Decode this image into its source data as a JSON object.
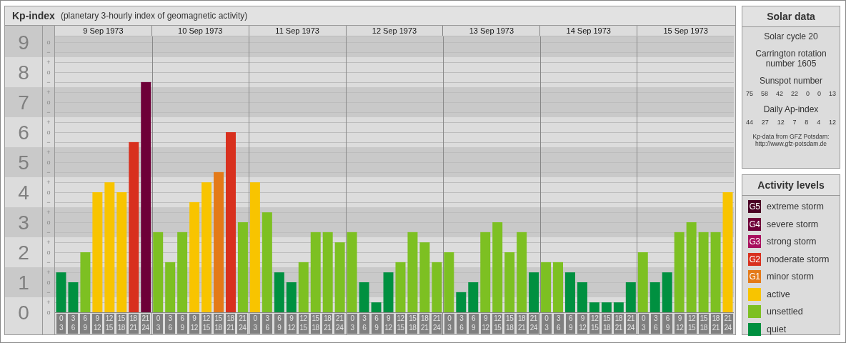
{
  "header": {
    "title": "Kp-index",
    "subtitle": "(planetary 3-hourly index of geomagnetic activity)"
  },
  "y_axis_minor": [
    [
      {
        "label": "o",
        "kind": "zero"
      },
      {
        "label": "−",
        "kind": "minus"
      }
    ],
    [
      {
        "label": "+",
        "kind": "plus"
      },
      {
        "label": "o",
        "kind": "zero"
      },
      {
        "label": "−",
        "kind": "minus"
      }
    ],
    [
      {
        "label": "+",
        "kind": "plus"
      },
      {
        "label": "o",
        "kind": "zero"
      },
      {
        "label": "−",
        "kind": "minus"
      }
    ],
    [
      {
        "label": "+",
        "kind": "plus"
      },
      {
        "label": "o",
        "kind": "zero"
      },
      {
        "label": "−",
        "kind": "minus"
      }
    ],
    [
      {
        "label": "+",
        "kind": "plus"
      },
      {
        "label": "o",
        "kind": "zero"
      },
      {
        "label": "−",
        "kind": "minus"
      }
    ],
    [
      {
        "label": "+",
        "kind": "plus"
      },
      {
        "label": "o",
        "kind": "zero"
      },
      {
        "label": "−",
        "kind": "minus"
      }
    ],
    [
      {
        "label": "+",
        "kind": "plus"
      },
      {
        "label": "o",
        "kind": "zero"
      },
      {
        "label": "−",
        "kind": "minus"
      }
    ],
    [
      {
        "label": "+",
        "kind": "plus"
      },
      {
        "label": "o",
        "kind": "zero"
      },
      {
        "label": "−",
        "kind": "minus"
      }
    ],
    [
      {
        "label": "+",
        "kind": "plus"
      },
      {
        "label": "o",
        "kind": "zero"
      },
      {
        "label": "−",
        "kind": "minus"
      }
    ],
    [
      {
        "label": "+",
        "kind": "plus"
      },
      {
        "label": "o",
        "kind": "zero"
      }
    ]
  ],
  "days": [
    {
      "date": "9 Sep 1973",
      "slots": [
        {
          "start": "0",
          "end": "3"
        },
        {
          "start": "3",
          "end": "6"
        },
        {
          "start": "6",
          "end": "9"
        },
        {
          "start": "9",
          "end": "12"
        },
        {
          "start": "12",
          "end": "15"
        },
        {
          "start": "15",
          "end": "18"
        },
        {
          "start": "18",
          "end": "21"
        },
        {
          "start": "21",
          "end": "24"
        }
      ]
    },
    {
      "date": "10 Sep 1973",
      "slots": [
        {
          "start": "0",
          "end": "3"
        },
        {
          "start": "3",
          "end": "6"
        },
        {
          "start": "6",
          "end": "9"
        },
        {
          "start": "9",
          "end": "12"
        },
        {
          "start": "12",
          "end": "15"
        },
        {
          "start": "15",
          "end": "18"
        },
        {
          "start": "18",
          "end": "21"
        },
        {
          "start": "21",
          "end": "24"
        }
      ]
    },
    {
      "date": "11 Sep 1973",
      "slots": [
        {
          "start": "0",
          "end": "3"
        },
        {
          "start": "3",
          "end": "6"
        },
        {
          "start": "6",
          "end": "9"
        },
        {
          "start": "9",
          "end": "12"
        },
        {
          "start": "12",
          "end": "15"
        },
        {
          "start": "15",
          "end": "18"
        },
        {
          "start": "18",
          "end": "21"
        },
        {
          "start": "21",
          "end": "24"
        }
      ]
    },
    {
      "date": "12 Sep 1973",
      "slots": [
        {
          "start": "0",
          "end": "3"
        },
        {
          "start": "3",
          "end": "6"
        },
        {
          "start": "6",
          "end": "9"
        },
        {
          "start": "9",
          "end": "12"
        },
        {
          "start": "12",
          "end": "15"
        },
        {
          "start": "15",
          "end": "18"
        },
        {
          "start": "18",
          "end": "21"
        },
        {
          "start": "21",
          "end": "24"
        }
      ]
    },
    {
      "date": "13 Sep 1973",
      "slots": [
        {
          "start": "0",
          "end": "3"
        },
        {
          "start": "3",
          "end": "6"
        },
        {
          "start": "6",
          "end": "9"
        },
        {
          "start": "9",
          "end": "12"
        },
        {
          "start": "12",
          "end": "15"
        },
        {
          "start": "15",
          "end": "18"
        },
        {
          "start": "18",
          "end": "21"
        },
        {
          "start": "21",
          "end": "24"
        }
      ]
    },
    {
      "date": "14 Sep 1973",
      "slots": [
        {
          "start": "0",
          "end": "3"
        },
        {
          "start": "3",
          "end": "6"
        },
        {
          "start": "6",
          "end": "9"
        },
        {
          "start": "9",
          "end": "12"
        },
        {
          "start": "12",
          "end": "15"
        },
        {
          "start": "15",
          "end": "18"
        },
        {
          "start": "18",
          "end": "21"
        },
        {
          "start": "21",
          "end": "24"
        }
      ]
    },
    {
      "date": "15 Sep 1973",
      "slots": [
        {
          "start": "0",
          "end": "3"
        },
        {
          "start": "3",
          "end": "6"
        },
        {
          "start": "6",
          "end": "9"
        },
        {
          "start": "9",
          "end": "12"
        },
        {
          "start": "12",
          "end": "15"
        },
        {
          "start": "15",
          "end": "18"
        },
        {
          "start": "18",
          "end": "21"
        },
        {
          "start": "21",
          "end": "24"
        }
      ]
    }
  ],
  "chart_data": {
    "type": "bar",
    "grid": true,
    "ylim": [
      0,
      9
    ],
    "yticks": [
      0,
      1,
      2,
      3,
      4,
      5,
      6,
      7,
      8,
      9
    ],
    "categories": [
      null,
      null,
      null,
      null,
      null,
      null,
      null,
      null,
      null,
      null,
      null,
      null,
      null,
      null,
      null,
      null,
      null,
      null,
      null,
      null,
      null,
      null,
      null,
      null,
      null,
      null,
      null,
      null,
      null,
      null,
      null,
      null,
      null,
      null,
      null,
      null,
      null,
      null,
      null,
      null,
      null,
      null,
      null,
      null,
      null,
      null,
      null,
      null,
      null,
      null,
      null,
      null,
      null,
      null,
      null,
      null
    ],
    "values": [
      1.33,
      1,
      2,
      4,
      4.33,
      4,
      5.67,
      7.67,
      2.67,
      1.67,
      2.67,
      3.67,
      4.33,
      4.67,
      6,
      3,
      4.33,
      3.33,
      1.33,
      1,
      1.67,
      2.67,
      2.67,
      2.33,
      2.67,
      1,
      0.33,
      1.33,
      1.67,
      2.67,
      2.33,
      1.67,
      2,
      0.67,
      1,
      2.67,
      3,
      2,
      2.67,
      1.33,
      1.67,
      1.67,
      1.33,
      1,
      0.33,
      0.33,
      0.33,
      1,
      2,
      1,
      1.33,
      2.67,
      3,
      2.67,
      2.67,
      4
    ]
  },
  "solar_data": {
    "title": "Solar data",
    "solar_cycle": "Solar cycle 20",
    "carrington": "Carrington rotation number 1605",
    "sunspot_label": "Sunspot number",
    "sunspot_numbers": [
      "75",
      "58",
      "42",
      "22",
      "0",
      "0",
      "13"
    ],
    "ap_label": "Daily Ap-index",
    "ap_values": [
      "44",
      "27",
      "12",
      "7",
      "8",
      "4",
      "12"
    ],
    "credit": "Kp-data from GFZ Potsdam:",
    "credit_url": "http://www.gfz-potsdam.de"
  },
  "activity_levels": {
    "title": "Activity levels",
    "items": [
      {
        "code": "G5",
        "label": "extreme storm",
        "color": "#4a0024"
      },
      {
        "code": "G4",
        "label": "severe storm",
        "color": "#6e0038"
      },
      {
        "code": "G3",
        "label": "strong storm",
        "color": "#a8105e"
      },
      {
        "code": "G2",
        "label": "moderate storm",
        "color": "#d8301e"
      },
      {
        "code": "G1",
        "label": "minor storm",
        "color": "#e47a18"
      },
      {
        "label": "active",
        "color": "#f8c400"
      },
      {
        "label": "unsettled",
        "color": "#7dc022"
      },
      {
        "label": "quiet",
        "color": "#009040"
      }
    ]
  }
}
